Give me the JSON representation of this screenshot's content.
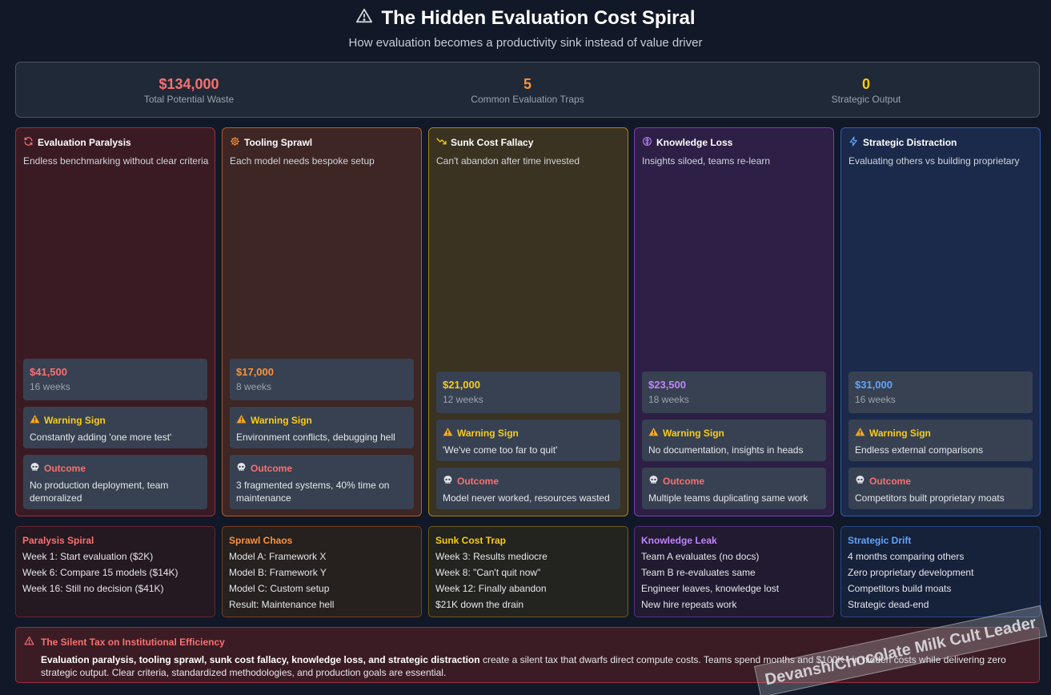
{
  "header": {
    "title": "The Hidden Evaluation Cost Spiral",
    "subtitle": "How evaluation becomes a productivity sink instead of value driver",
    "icon": "warning-triangle-icon"
  },
  "stats": [
    {
      "value": "$134,000",
      "label": "Total Potential Waste",
      "color": "#f87171"
    },
    {
      "value": "5",
      "label": "Common Evaluation Traps",
      "color": "#fb923c"
    },
    {
      "value": "0",
      "label": "Strategic Output",
      "color": "#facc15"
    }
  ],
  "box_labels": {
    "warning": "Warning Sign",
    "outcome": "Outcome"
  },
  "cards": [
    {
      "title": "Evaluation Paralysis",
      "icon": "refresh-icon",
      "desc": "Endless benchmarking without clear criteria",
      "cost": "$41,500",
      "duration": "16 weeks",
      "warning": "Constantly adding 'one more test'",
      "outcome": "No production deployment, team demoralized",
      "accent": "#f87171",
      "bg": "#3a1b24",
      "border": "#9b2c3a"
    },
    {
      "title": "Tooling Sprawl",
      "icon": "gear-icon",
      "desc": "Each model needs bespoke setup",
      "cost": "$17,000",
      "duration": "8 weeks",
      "warning": "Environment conflicts, debugging hell",
      "outcome": "3 fragmented systems, 40% time on maintenance",
      "accent": "#fb923c",
      "bg": "#3d2624",
      "border": "#b45a24"
    },
    {
      "title": "Sunk Cost Fallacy",
      "icon": "trending-down-icon",
      "desc": "Can't abandon after time invested",
      "cost": "$21,000",
      "duration": "12 weeks",
      "warning": "'We've come too far to quit'",
      "outcome": "Model never worked, resources wasted",
      "accent": "#facc15",
      "bg": "#3a3322",
      "border": "#a18316"
    },
    {
      "title": "Knowledge Loss",
      "icon": "brain-icon",
      "desc": "Insights siloed, teams re-learn",
      "cost": "$23,500",
      "duration": "18 weeks",
      "warning": "No documentation, insights in heads",
      "outcome": "Multiple teams duplicating same work",
      "accent": "#c084fc",
      "bg": "#2d1f45",
      "border": "#7e3bb5"
    },
    {
      "title": "Strategic Distraction",
      "icon": "lightning-icon",
      "desc": "Evaluating others vs building proprietary",
      "cost": "$31,000",
      "duration": "16 weeks",
      "warning": "Endless external comparisons",
      "outcome": "Competitors built proprietary moats",
      "accent": "#60a5fa",
      "bg": "#1b2a4a",
      "border": "#2f5ca8"
    }
  ],
  "stories": [
    {
      "title": "Paralysis Spiral",
      "lines": [
        "Week 1: Start evaluation ($2K)",
        "Week 6: Compare 15 models ($14K)",
        "Week 16: Still no decision ($41K)"
      ],
      "accent": "#f87171",
      "bg": "#241821",
      "border": "#6b2231"
    },
    {
      "title": "Sprawl Chaos",
      "lines": [
        "Model A: Framework X",
        "Model B: Framework Y",
        "Model C: Custom setup",
        "Result: Maintenance hell"
      ],
      "accent": "#fb923c",
      "bg": "#26201f",
      "border": "#7a3f1d"
    },
    {
      "title": "Sunk Cost Trap",
      "lines": [
        "Week 3: Results mediocre",
        "Week 8: \"Can't quit now\"",
        "Week 12: Finally abandon",
        "$21K down the drain"
      ],
      "accent": "#facc15",
      "bg": "#23231f",
      "border": "#6e5a14"
    },
    {
      "title": "Knowledge Leak",
      "lines": [
        "Team A evaluates (no docs)",
        "Team B re-evaluates same",
        "Engineer leaves, knowledge lost",
        "New hire repeats work"
      ],
      "accent": "#c084fc",
      "bg": "#211a30",
      "border": "#5a2e84"
    },
    {
      "title": "Strategic Drift",
      "lines": [
        "4 months comparing others",
        "Zero proprietary development",
        "Competitors build moats",
        "Strategic dead-end"
      ],
      "accent": "#60a5fa",
      "bg": "#16213a",
      "border": "#264a85"
    }
  ],
  "note": {
    "title": "The Silent Tax on Institutional Efficiency",
    "bold": "Evaluation paralysis, tooling sprawl, sunk cost fallacy, knowledge loss, and strategic distraction",
    "rest": " create a silent tax that dwarfs direct compute costs. Teams spend months and $100K+ in hidden costs while delivering zero strategic output. Clear criteria, standardized methodologies, and production goals are essential.",
    "icon": "alert-triangle-icon"
  },
  "watermark": "Devansh/Chocolate Milk Cult Leader"
}
